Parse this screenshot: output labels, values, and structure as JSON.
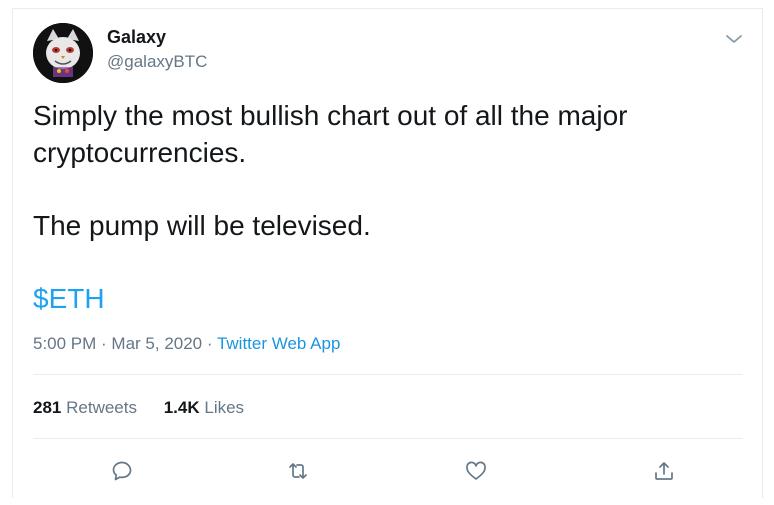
{
  "tweet": {
    "author": {
      "name": "Galaxy",
      "handle": "@galaxyBTC",
      "avatar_icon": "cat-avatar-icon"
    },
    "text_lines": [
      "Simply the most bullish chart out of all the major",
      "cryptocurrencies.",
      "The pump will be televised."
    ],
    "cashtag": "$ETH",
    "timestamp": "5:00 PM · Mar 5, 2020",
    "separator": " · ",
    "source_app": "Twitter Web App",
    "stats": {
      "retweets_count": "281",
      "retweets_label": "Retweets",
      "likes_count": "1.4K",
      "likes_label": "Likes"
    },
    "actions": [
      {
        "icon": "reply-icon"
      },
      {
        "icon": "retweet-icon"
      },
      {
        "icon": "like-icon"
      },
      {
        "icon": "share-icon"
      }
    ],
    "colors": {
      "link": "#1da1f2",
      "muted": "#657786",
      "text": "#14171a",
      "border": "#e6ecf0"
    }
  }
}
